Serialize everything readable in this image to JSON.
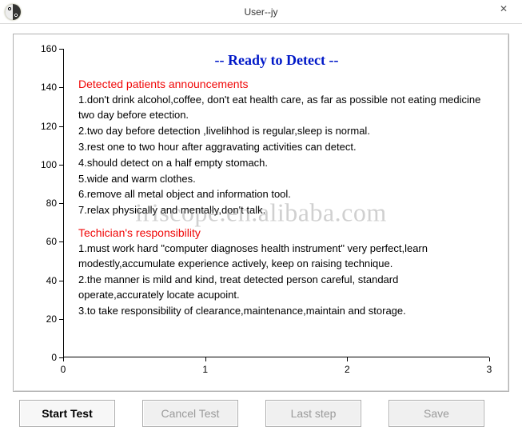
{
  "window": {
    "title": "User--jy",
    "close_label": "✕"
  },
  "chart_data": {
    "type": "line",
    "title": "-- Ready to Detect --",
    "x": [],
    "y": [],
    "xlim": [
      0,
      3
    ],
    "ylim": [
      0,
      160
    ],
    "xticks": [
      0,
      1,
      2,
      3
    ],
    "yticks": [
      0,
      20,
      40,
      60,
      80,
      100,
      120,
      140,
      160
    ],
    "xlabel": "",
    "ylabel": ""
  },
  "announcements": {
    "heading": "Detected patients announcements",
    "items": [
      "1.don't drink alcohol,coffee, don't eat health care, as far as possible not eating medicine two day before etection.",
      "2.two day before detection ,livelihhod is regular,sleep is normal.",
      "3.rest one to two hour after aggravating activities can detect.",
      "4.should detect on a half empty stomach.",
      "5.wide and warm clothes.",
      "6.remove all metal object and information tool.",
      "7.relax physically and mentally,don't talk."
    ]
  },
  "responsibility": {
    "heading": "Techician's responsibility",
    "items": [
      "1.must work hard \"computer diagnoses health instrument\" very perfect,learn modestly,accumulate experience actively, keep on raising technique.",
      "2.the manner is mild and kind, treat detected person careful, standard operate,accurately locate acupoint.",
      "3.to take responsibility of clearance,maintenance,maintain and storage."
    ]
  },
  "watermark": "iriscope.en.alibaba.com",
  "buttons": {
    "start": "Start Test",
    "cancel": "Cancel Test",
    "last": "Last step",
    "save": "Save"
  }
}
